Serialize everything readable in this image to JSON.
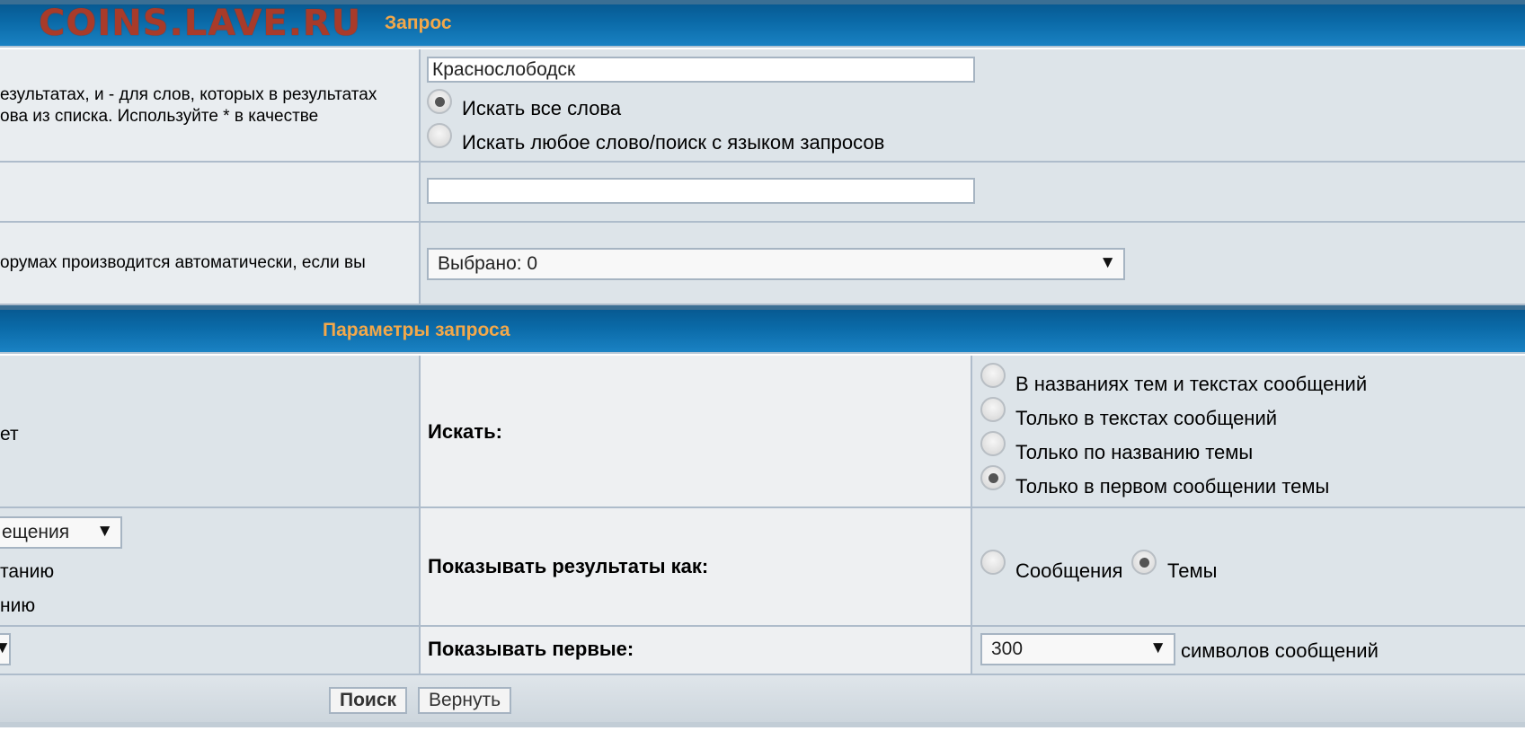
{
  "header": {
    "logo": "COINS.LAVE.RU",
    "title": "Запрос"
  },
  "query": {
    "help_line1": "езультатах, и - для слов, которых в результатах",
    "help_line2": "ова из списка. Используйте * в качестве",
    "keywords_value": "Краснослободск",
    "mode_all_label": "Искать все слова",
    "mode_any_label": "Искать любое слово/поиск с языком запросов",
    "author_value": "",
    "forums_help": "орумах производится автоматически, если вы",
    "forums_selected": "Выбрано: 0"
  },
  "params": {
    "title": "Параметры запроса",
    "left_partial_1": "ет",
    "search_in_label": "Искать:",
    "search_in_options": [
      "В названиях тем и текстах сообщений",
      "Только в текстах сообщений",
      "Только по названию темы",
      "Только в первом сообщении темы"
    ],
    "sort_select_partial": "ещения",
    "sort_dir_partial_1": "танию",
    "sort_dir_partial_2": "нию",
    "show_as_label": "Показывать результаты как:",
    "show_as_posts": "Сообщения",
    "show_as_topics": "Темы",
    "show_first_label": "Показывать первые:",
    "show_first_value": "300",
    "show_first_suffix": "символов сообщений"
  },
  "footer": {
    "search_button": "Поиск",
    "reset_button": "Вернуть"
  },
  "colors": {
    "header_blue": "#0b6ba9",
    "header_title": "#f3a84a",
    "logo": "#a83b2a"
  }
}
